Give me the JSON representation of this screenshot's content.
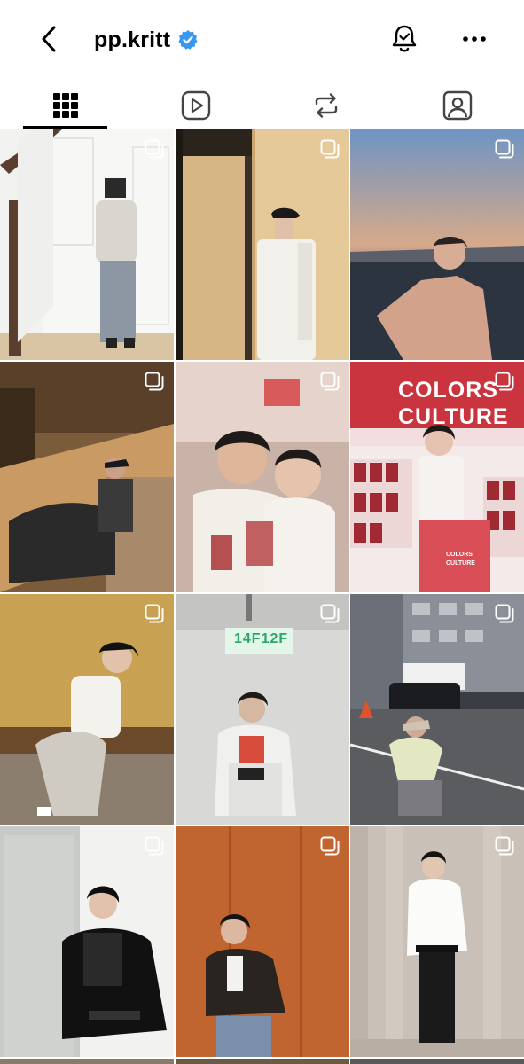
{
  "header": {
    "username": "pp.kritt",
    "verified": true,
    "back_icon": "chevron-left-icon",
    "bell_icon": "bell-icon",
    "more_icon": "more-horizontal-icon"
  },
  "tabs": [
    {
      "name": "grid",
      "icon": "grid-icon",
      "active": true
    },
    {
      "name": "reels",
      "icon": "reels-icon",
      "active": false
    },
    {
      "name": "reposts",
      "icon": "repost-icon",
      "active": false
    },
    {
      "name": "tagged",
      "icon": "tagged-icon",
      "active": false
    }
  ],
  "colors": {
    "text": "#000000",
    "verified_blue": "#3897f0",
    "background": "#ffffff"
  },
  "posts": {
    "p5_text_1": "COLORS",
    "p5_text_2": "CULTURE",
    "p5_box_text_1": "COLORS",
    "p5_box_text_2": "CULTURE",
    "p7_sign": "14F12F"
  }
}
